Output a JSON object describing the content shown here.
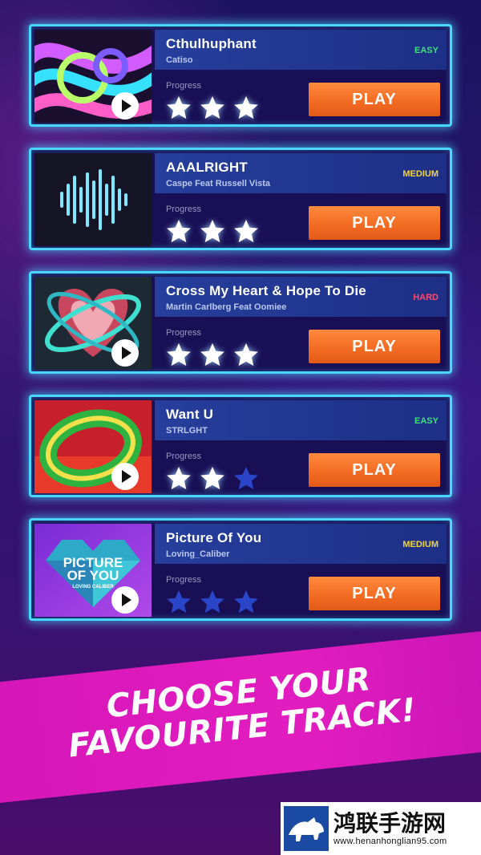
{
  "tracks": [
    {
      "title": "Cthulhuphant",
      "artist": "Catiso",
      "difficulty": "EASY",
      "difficulty_color": "#3ee37a",
      "progress_label": "Progress",
      "stars_filled": 3,
      "play_label": "PLAY",
      "art": "abstract-neon-swirl"
    },
    {
      "title": "AAALRIGHT",
      "artist": "Caspe Feat Russell Vista",
      "difficulty": "MEDIUM",
      "difficulty_color": "#f2d43b",
      "progress_label": "Progress",
      "stars_filled": 3,
      "play_label": "PLAY",
      "art": "waveform"
    },
    {
      "title": "Cross My Heart & Hope To Die",
      "artist": "Martin Carlberg Feat Oomiee",
      "difficulty": "HARD",
      "difficulty_color": "#ff4a6a",
      "progress_label": "Progress",
      "stars_filled": 3,
      "play_label": "PLAY",
      "art": "heart-orbit"
    },
    {
      "title": "Want U",
      "artist": "STRLGHT",
      "difficulty": "EASY",
      "difficulty_color": "#3ee37a",
      "progress_label": "Progress",
      "stars_filled": 2,
      "play_label": "PLAY",
      "art": "ring-red-green"
    },
    {
      "title": "Picture Of You",
      "artist": "Loving_Caliber",
      "difficulty": "MEDIUM",
      "difficulty_color": "#f2d43b",
      "progress_label": "Progress",
      "stars_filled": 0,
      "play_label": "PLAY",
      "art": "crystal-heart",
      "art_text": [
        "PICTURE",
        "OF YOU",
        "LOVING CALIBER"
      ]
    }
  ],
  "banner": {
    "line1": "CHOOSE YOUR",
    "line2": "FAVOURITE TRACK!"
  },
  "watermark": {
    "name": "鸿联手游网",
    "url": "www.henanhonglian95.com"
  },
  "colors": {
    "accent_border": "#49d7ff",
    "play_button": "#f26a22",
    "banner": "#e21dc0",
    "star_empty": "#2a45c8"
  }
}
